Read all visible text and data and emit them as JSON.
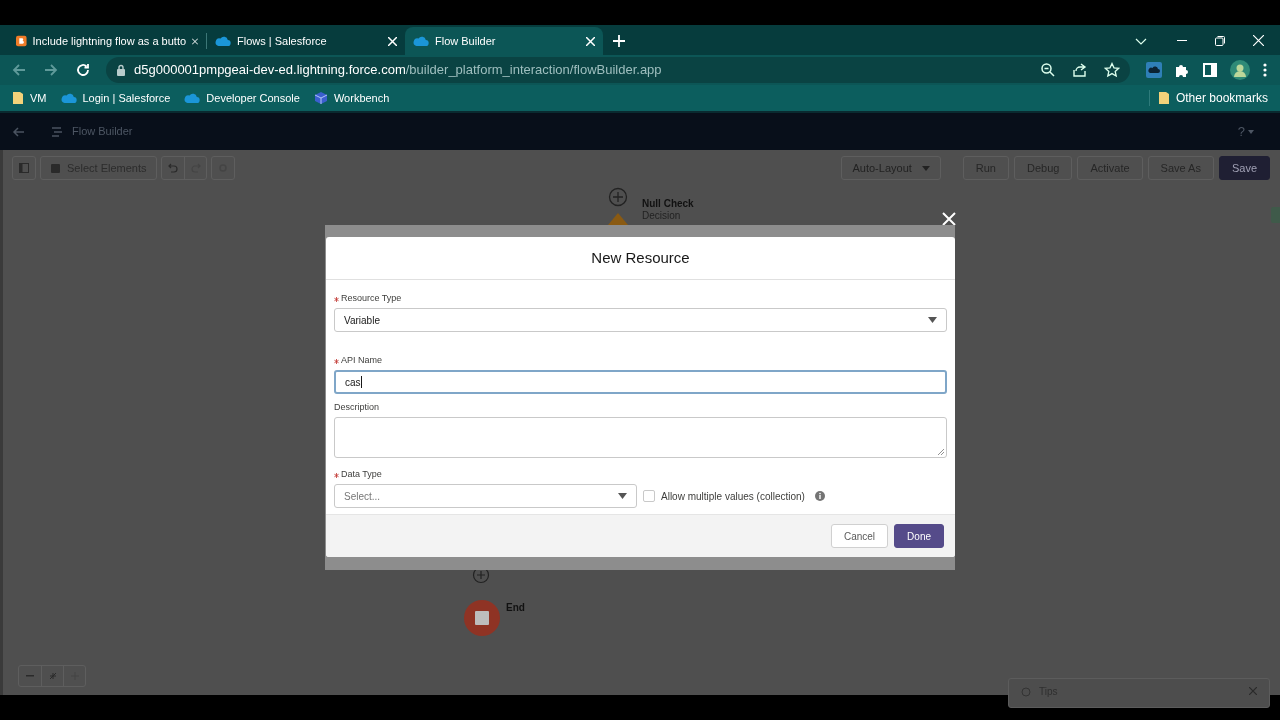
{
  "browser": {
    "tabs": [
      {
        "title": "Include lightning flow as a butto",
        "kind": "blog",
        "selected": false
      },
      {
        "title": "Flows | Salesforce",
        "kind": "cloud",
        "selected": false
      },
      {
        "title": "Flow Builder",
        "kind": "cloud",
        "selected": true
      }
    ],
    "url_host": "d5g000001pmpgeai-dev-ed.lightning.force.com",
    "url_path": "/builder_platform_interaction/flowBuilder.app",
    "bookmarks": [
      {
        "label": "VM",
        "kind": "folder"
      },
      {
        "label": "Login | Salesforce",
        "kind": "cloud"
      },
      {
        "label": "Developer Console",
        "kind": "cloud"
      },
      {
        "label": "Workbench",
        "kind": "cube"
      }
    ],
    "other_bookmarks": "Other bookmarks"
  },
  "app_header": {
    "title": "Flow Builder",
    "help": "?"
  },
  "toolbar": {
    "select_elements": "Select Elements",
    "layout": "Auto-Layout",
    "buttons": [
      {
        "label": "Run",
        "disabled": true,
        "primary": false
      },
      {
        "label": "Debug",
        "disabled": true,
        "primary": false
      },
      {
        "label": "Activate",
        "disabled": true,
        "primary": false
      },
      {
        "label": "Save As",
        "disabled": true,
        "primary": false
      },
      {
        "label": "Save",
        "disabled": false,
        "primary": true
      }
    ]
  },
  "canvas": {
    "nodes": [
      {
        "kind": "decision",
        "title": "Null Check",
        "subtitle": "Decision"
      },
      {
        "kind": "end",
        "title": "End"
      }
    ],
    "tips": "Tips"
  },
  "modal": {
    "title": "New Resource",
    "fields": [
      {
        "kind": "select",
        "label": "Resource Type",
        "required": true,
        "value": "Variable"
      },
      {
        "kind": "input",
        "label": "API Name",
        "required": true,
        "value": "cas",
        "focused": true
      },
      {
        "kind": "textarea",
        "label": "Description",
        "required": false
      },
      {
        "kind": "select",
        "label": "Data Type",
        "required": true,
        "placeholder": "Select..."
      }
    ],
    "collection": {
      "label": "Allow multiple values (collection)",
      "checked": false
    },
    "buttons": [
      {
        "label": "Cancel",
        "primary": false
      },
      {
        "label": "Done",
        "primary": true
      }
    ]
  }
}
